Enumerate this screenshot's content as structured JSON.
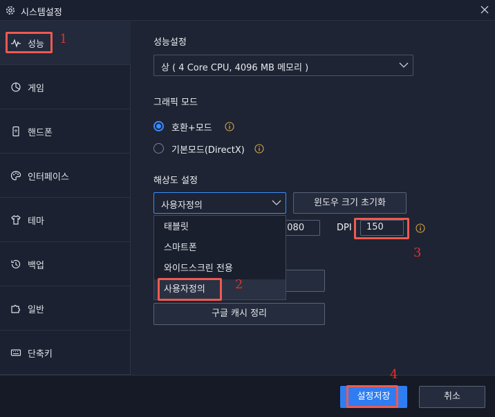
{
  "window": {
    "title": "시스템설정",
    "close_icon": "close-icon"
  },
  "sidebar": {
    "items": [
      {
        "label": "성능",
        "icon": "pulse-icon",
        "active": true
      },
      {
        "label": "게임",
        "icon": "game-icon"
      },
      {
        "label": "핸드폰",
        "icon": "phone-icon"
      },
      {
        "label": "인터페이스",
        "icon": "palette-icon"
      },
      {
        "label": "테마",
        "icon": "shirt-icon"
      },
      {
        "label": "백업",
        "icon": "history-icon"
      },
      {
        "label": "일반",
        "icon": "puzzle-icon"
      },
      {
        "label": "단축키",
        "icon": "keyboard-icon"
      }
    ]
  },
  "performance": {
    "section_title": "성능설정",
    "selected": "상 ( 4 Core CPU, 4096 MB 메모리 )"
  },
  "graphics": {
    "section_title": "그래픽 모드",
    "options": [
      "호환+모드",
      "기본모드(DirectX)"
    ],
    "selected_index": 0
  },
  "resolution": {
    "section_title": "해상도 설정",
    "selected": "사용자정의",
    "reset_button": "윈도우 크기 초기화",
    "height_value": "1080",
    "dpi_label": "DPI",
    "dpi_value": "150",
    "dropdown_options": [
      "태블릿",
      "스마트폰",
      "와이드스크린 전용",
      "사용자정의"
    ],
    "cache_button": "구글 캐시 정리"
  },
  "footer": {
    "save_button": "설정저장",
    "cancel_button": "취소"
  },
  "annotations": {
    "n1": "1",
    "n2": "2",
    "n3": "3",
    "n4": "4"
  },
  "colors": {
    "accent": "#3b8cff",
    "primary_button": "#2f7df2",
    "highlight": "#ef5a50",
    "number": "#e0312a"
  }
}
